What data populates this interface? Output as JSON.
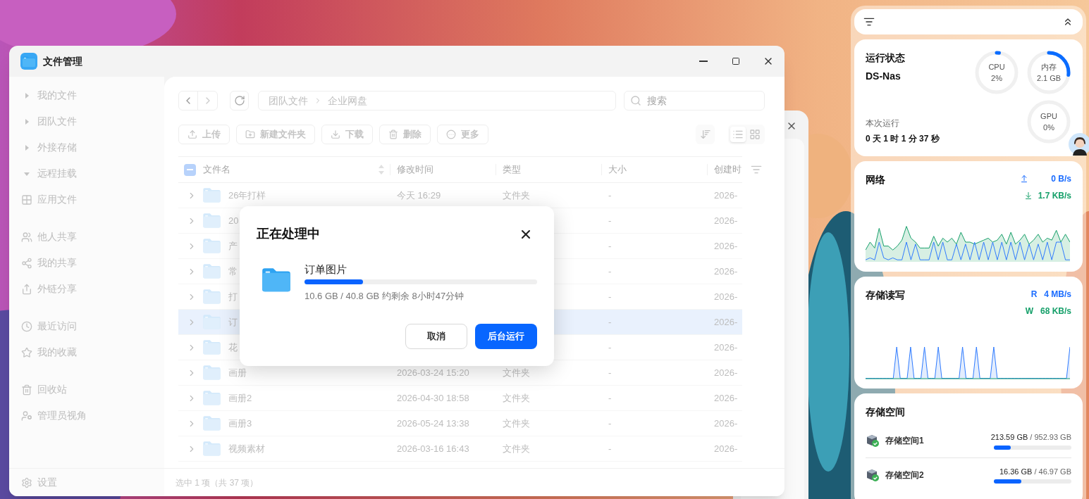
{
  "window": {
    "title": "文件管理"
  },
  "sidebar": {
    "groups": [
      [
        {
          "kind": "tree",
          "label": "我的文件",
          "expanded": false
        },
        {
          "kind": "tree",
          "label": "团队文件",
          "expanded": false
        },
        {
          "kind": "tree",
          "label": "外接存储",
          "expanded": false
        },
        {
          "kind": "tree",
          "label": "远程挂载",
          "expanded": true
        },
        {
          "kind": "link",
          "label": "应用文件"
        }
      ],
      [
        {
          "kind": "link",
          "label": "他人共享"
        },
        {
          "kind": "link",
          "label": "我的共享"
        },
        {
          "kind": "link",
          "label": "外链分享"
        }
      ],
      [
        {
          "kind": "link",
          "label": "最近访问"
        },
        {
          "kind": "link",
          "label": "我的收藏"
        }
      ],
      [
        {
          "kind": "link",
          "label": "回收站"
        },
        {
          "kind": "link",
          "label": "管理员视角"
        }
      ]
    ],
    "settings": "设置"
  },
  "nav": {
    "breadcrumb": [
      "团队文件",
      "企业网盘"
    ],
    "search": {
      "placeholder": "搜索"
    }
  },
  "toolbar": [
    "上传",
    "新建文件夹",
    "下载",
    "删除",
    "更多"
  ],
  "view_toggle": [
    {
      "kind": "list",
      "selected": true
    },
    {
      "kind": "grid",
      "selected": false
    }
  ],
  "table": {
    "select_all": {
      "partial": true
    },
    "columns": [
      "文件名",
      "修改时间",
      "类型",
      "大小",
      "创建时"
    ],
    "rows": [
      {
        "name": "26年打样",
        "modified": "今天 16:29",
        "type": "文件夹",
        "size": "-",
        "created": "2026-",
        "selected": false
      },
      {
        "name": "20",
        "size": "-",
        "created": "2026-",
        "selected": false
      },
      {
        "name": "产",
        "size": "-",
        "created": "2026-",
        "selected": false
      },
      {
        "name": "常",
        "size": "-",
        "created": "2026-",
        "selected": false
      },
      {
        "name": "打",
        "size": "-",
        "created": "2026-",
        "selected": false
      },
      {
        "name": "订",
        "size": "-",
        "created": "2026-",
        "selected": true
      },
      {
        "name": "花",
        "size": "-",
        "created": "2026-",
        "selected": false
      },
      {
        "name": "画册",
        "modified": "2026-03-24 15:20",
        "type": "文件夹",
        "size": "-",
        "created": "2026-",
        "selected": false
      },
      {
        "name": "画册2",
        "modified": "2026-04-30 18:58",
        "type": "文件夹",
        "size": "-",
        "created": "2026-",
        "selected": false
      },
      {
        "name": "画册3",
        "modified": "2026-05-24 13:38",
        "type": "文件夹",
        "size": "-",
        "created": "2026-",
        "selected": false
      },
      {
        "name": "视频素材",
        "modified": "2026-03-16 16:43",
        "type": "文件夹",
        "size": "-",
        "created": "2026-",
        "selected": false
      }
    ]
  },
  "status_bar": "选中 1 项（共 37 项）",
  "dialog": {
    "title": "正在处理中",
    "file": "订单图片",
    "level": 0.25,
    "progress_text": "10.6 GB / 40.8 GB 约剩余 8小时47分钟",
    "buttons": [
      {
        "kind": "secondary",
        "label": "取消"
      },
      {
        "kind": "primary",
        "label": "后台运行"
      }
    ]
  },
  "widgets": {
    "status": {
      "title": "运行状态",
      "host": "DS-Nas",
      "gauges": [
        {
          "label": "CPU",
          "reading": "2%",
          "level": 0.02
        },
        {
          "label": "内存",
          "reading": "2.1 GB",
          "level": 0.27
        },
        {
          "label": "GPU",
          "reading": "0%",
          "level": 0
        }
      ],
      "uptime_label": "本次运行",
      "uptime": "0 天 1 时 1 分 37 秒"
    },
    "network": {
      "title": "网络",
      "rates": [
        {
          "kind": "up",
          "value": "0 B/s"
        },
        {
          "kind": "down",
          "value": "1.7 KB/s"
        }
      ]
    },
    "storage_io": {
      "title": "存储读写",
      "rates": [
        {
          "kind": "read",
          "label": "R",
          "value": "4 MB/s"
        },
        {
          "kind": "write",
          "label": "W",
          "value": "68 KB/s"
        }
      ]
    },
    "storage": {
      "title": "存储空间",
      "volumes": [
        {
          "name": "存储空间1",
          "used": "213.59 GB",
          "total": "/ 952.93 GB",
          "level": 0.22
        },
        {
          "name": "存储空间2",
          "used": "16.36 GB",
          "total": "/ 46.97 GB",
          "level": 0.35
        }
      ]
    }
  }
}
